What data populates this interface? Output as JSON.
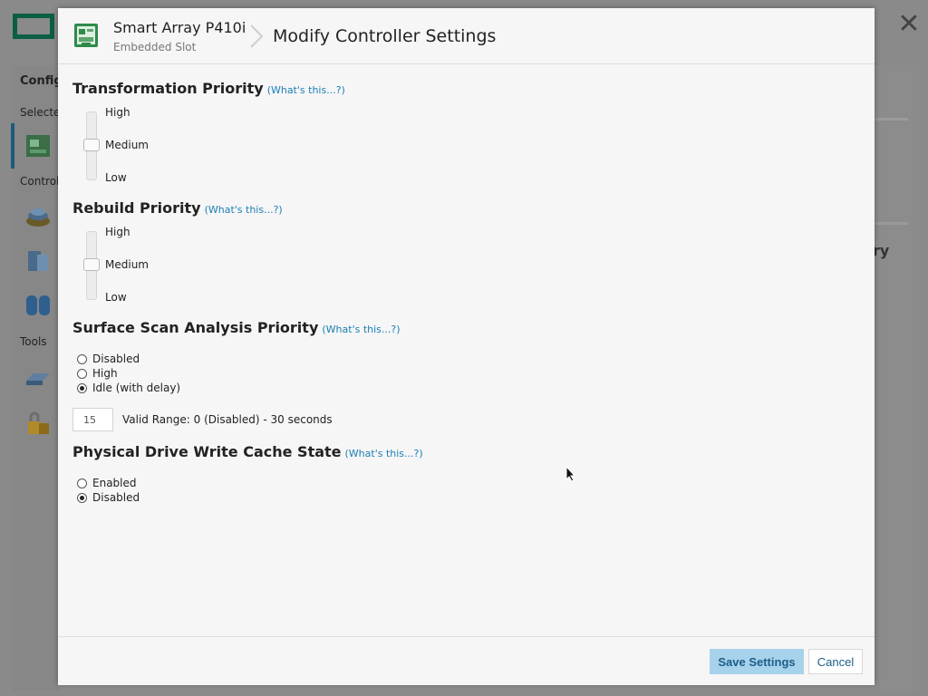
{
  "background": {
    "sidebar": {
      "config_label": "Configu",
      "selected_label": "Selecte",
      "controller_label": "Control",
      "tools_label": "Tools"
    },
    "right_text": "ry"
  },
  "modal": {
    "header": {
      "device_name": "Smart Array P410i",
      "device_slot": "Embedded Slot",
      "page_title": "Modify Controller Settings",
      "icon": "controller-card-icon"
    },
    "whats_this": "(What's this...?)",
    "transformation_priority": {
      "title": "Transformation Priority",
      "levels": [
        "High",
        "Medium",
        "Low"
      ],
      "selected": "Medium"
    },
    "rebuild_priority": {
      "title": "Rebuild Priority",
      "levels": [
        "High",
        "Medium",
        "Low"
      ],
      "selected": "Medium"
    },
    "surface_scan": {
      "title": "Surface Scan Analysis Priority",
      "options": [
        "Disabled",
        "High",
        "Idle (with delay)"
      ],
      "selected": "Idle (with delay)",
      "delay_value": "15",
      "valid_range": "Valid Range: 0 (Disabled) - 30 seconds"
    },
    "write_cache": {
      "title": "Physical Drive Write Cache State",
      "options": [
        "Enabled",
        "Disabled"
      ],
      "selected": "Disabled"
    },
    "footer": {
      "save_label": "Save Settings",
      "cancel_label": "Cancel"
    }
  },
  "colors": {
    "accent": "#1a7fb5",
    "save_button_bg": "#a7d2ec",
    "logo_green": "#0b5e45"
  }
}
